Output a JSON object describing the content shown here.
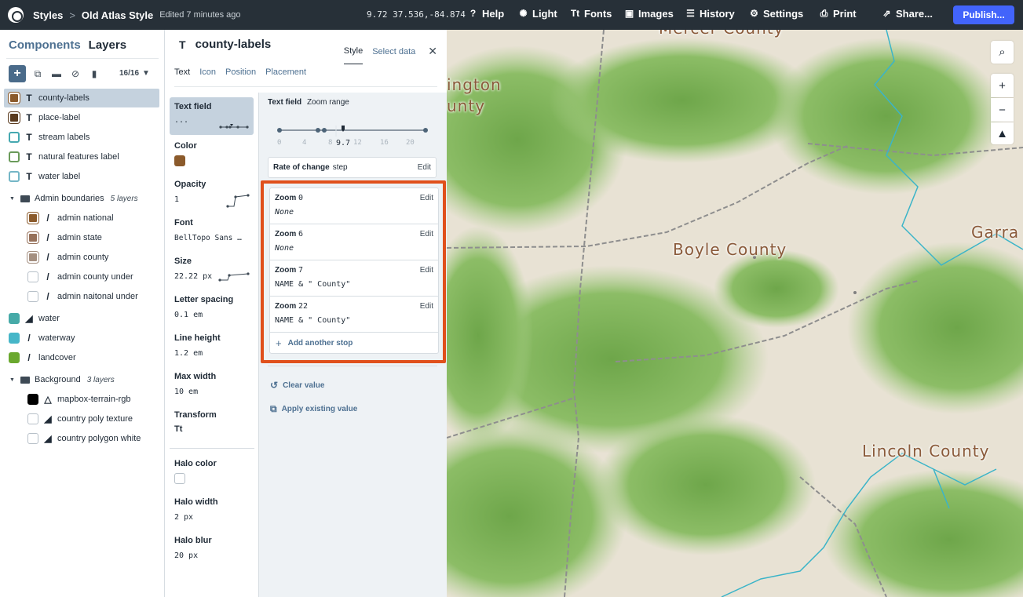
{
  "topbar": {
    "breadcrumb_root": "Styles",
    "breadcrumb_sep": ">",
    "style_name": "Old Atlas Style",
    "edited": "Edited 7 minutes ago",
    "coords": "9.72 37.536,-84.874",
    "nav": [
      {
        "label": "Help",
        "icon": "help-icon"
      },
      {
        "label": "Light",
        "icon": "sun-icon"
      },
      {
        "label": "Fonts",
        "icon": "font-icon"
      },
      {
        "label": "Images",
        "icon": "image-icon"
      },
      {
        "label": "History",
        "icon": "history-icon"
      },
      {
        "label": "Settings",
        "icon": "gear-icon"
      },
      {
        "label": "Print",
        "icon": "print-icon"
      },
      {
        "label": "Share...",
        "icon": "share-icon"
      }
    ],
    "publish": "Publish..."
  },
  "sidebar": {
    "tabs": [
      "Components",
      "Layers"
    ],
    "count": "16/16",
    "layers": [
      {
        "name": "county-labels",
        "type": "symbol",
        "color": "#8b5a2b",
        "selected": true
      },
      {
        "name": "place-label",
        "type": "symbol",
        "color": "#5a3a1e"
      },
      {
        "name": "stream labels",
        "type": "symbol",
        "color": "#ffffff",
        "border": "#45a8b0"
      },
      {
        "name": "natural features label",
        "type": "symbol",
        "color": "#ffffff",
        "border": "#6a9b5a"
      },
      {
        "name": "water label",
        "type": "symbol",
        "color": "#ffffff",
        "border": "#74b6c6"
      }
    ],
    "group1": {
      "name": "Admin boundaries",
      "count": "5 layers"
    },
    "group1_layers": [
      {
        "name": "admin national",
        "color": "#8b5a2b"
      },
      {
        "name": "admin state",
        "color": "#96715a"
      },
      {
        "name": "admin county",
        "color": "#a48f80"
      },
      {
        "name": "admin county under",
        "color": "#ffffff"
      },
      {
        "name": "admin naitonal under",
        "color": "#ffffff"
      }
    ],
    "mid_layers": [
      {
        "name": "water",
        "color": "#46aaa8"
      },
      {
        "name": "waterway",
        "color": "#46b6c8"
      },
      {
        "name": "landcover",
        "color": "#6aa82e"
      }
    ],
    "group2": {
      "name": "Background",
      "count": "3 layers"
    },
    "group2_layers": [
      {
        "name": "mapbox-terrain-rgb",
        "color": "#000000"
      },
      {
        "name": "country poly texture",
        "color": "#ffffff"
      },
      {
        "name": "country polygon white",
        "color": "#ffffff"
      }
    ]
  },
  "panel": {
    "title": "county-labels",
    "tabs": [
      "Style",
      "Select data"
    ],
    "subtabs": [
      "Text",
      "Icon",
      "Position",
      "Placement"
    ],
    "props": {
      "text_field": {
        "label": "Text field",
        "value": "..."
      },
      "color": {
        "label": "Color",
        "value": "#8b5a2b"
      },
      "opacity": {
        "label": "Opacity",
        "value": "1"
      },
      "font": {
        "label": "Font",
        "value": "BellTopo Sans …"
      },
      "size": {
        "label": "Size",
        "value": "22.22 px"
      },
      "letter_spacing": {
        "label": "Letter spacing",
        "value": "0.1 em"
      },
      "line_height": {
        "label": "Line height",
        "value": "1.2 em"
      },
      "max_width": {
        "label": "Max width",
        "value": "10 em"
      },
      "transform": {
        "label": "Transform",
        "value": "Tt"
      },
      "halo_color": {
        "label": "Halo color"
      },
      "halo_width": {
        "label": "Halo width",
        "value": "2 px"
      },
      "halo_blur": {
        "label": "Halo blur",
        "value": "20 px"
      }
    }
  },
  "detail": {
    "label_bold": "Text field",
    "label_rest": "Zoom range",
    "slider_ticks": [
      "0",
      "4",
      "8",
      "12",
      "16",
      "20"
    ],
    "current_zoom": "9.7",
    "rate_label": "Rate of change",
    "rate_value": "step",
    "edit": "Edit",
    "stops": [
      {
        "zoom_label": "Zoom",
        "zoom": "0",
        "value": "None",
        "italic": true
      },
      {
        "zoom_label": "Zoom",
        "zoom": "6",
        "value": "None",
        "italic": true
      },
      {
        "zoom_label": "Zoom",
        "zoom": "7",
        "value": "NAME & \" County\"",
        "italic": false
      },
      {
        "zoom_label": "Zoom",
        "zoom": "22",
        "value": "NAME & \" County\"",
        "italic": false
      }
    ],
    "add_stop": "Add another stop",
    "clear": "Clear value",
    "apply": "Apply existing value"
  },
  "map": {
    "labels": [
      "Mercer County",
      "ington",
      "unty",
      "Boyle County",
      "Garra",
      "Lincoln County"
    ],
    "colors": {
      "label": "#8a5a3a",
      "forest": "#7fb25a",
      "river": "#3bb4c8",
      "boundary": "#8b8b8b"
    }
  }
}
